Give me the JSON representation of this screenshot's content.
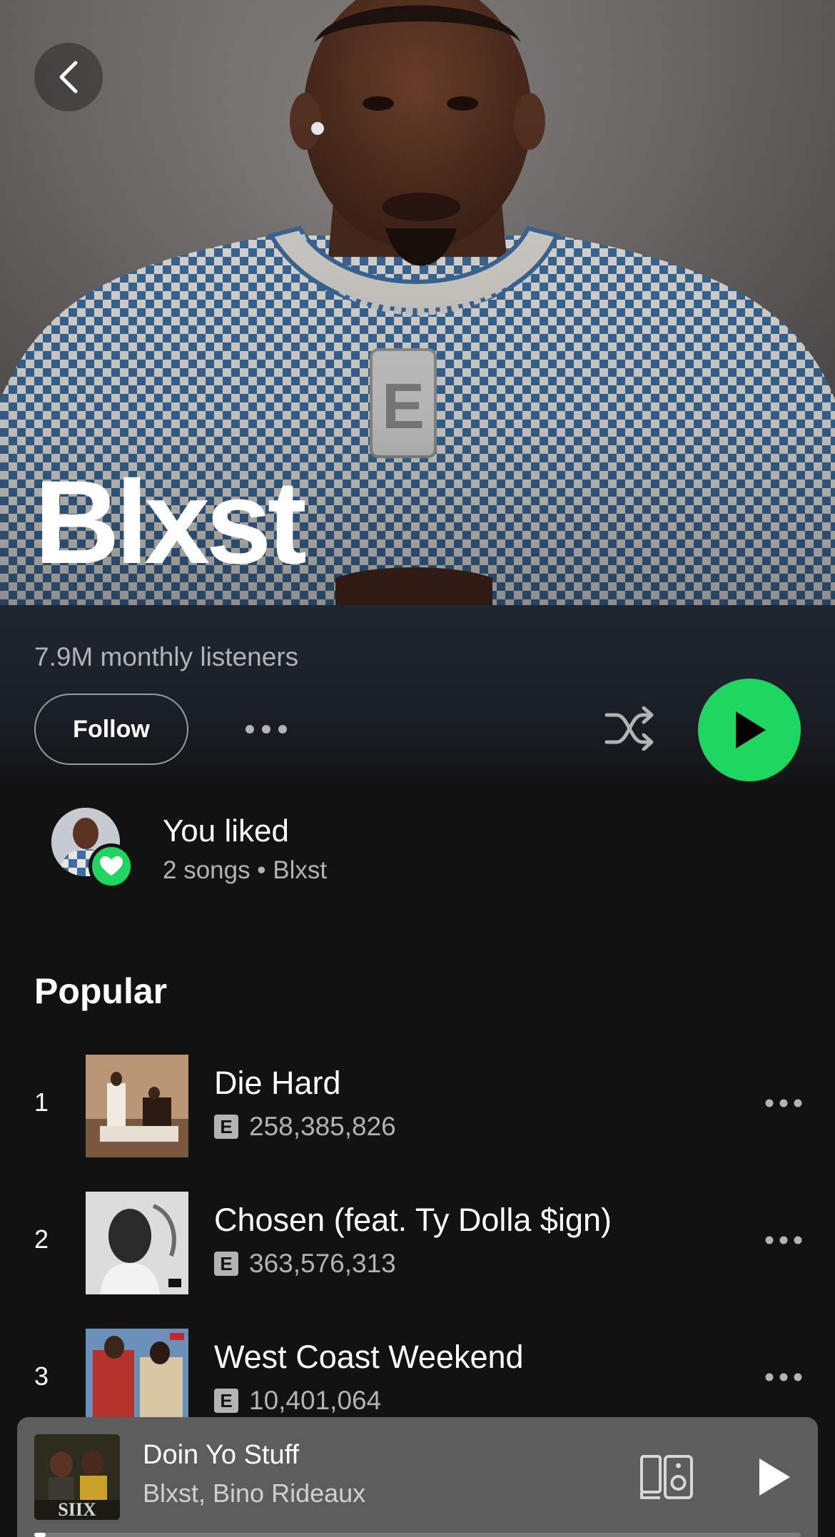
{
  "artist": {
    "name": "Blxst",
    "monthly_listeners": "7.9M monthly listeners"
  },
  "actions": {
    "follow_label": "Follow",
    "more_icon": "more-horizontal-icon",
    "shuffle_icon": "shuffle-icon",
    "play_icon": "play-icon",
    "back_icon": "chevron-left-icon"
  },
  "liked": {
    "title": "You liked",
    "subtitle": "2 songs • Blxst"
  },
  "popular": {
    "heading": "Popular",
    "tracks": [
      {
        "rank": "1",
        "title": "Die Hard",
        "explicit": "E",
        "plays": "258,385,826"
      },
      {
        "rank": "2",
        "title": "Chosen (feat. Ty Dolla $ign)",
        "explicit": "E",
        "plays": "363,576,313"
      },
      {
        "rank": "3",
        "title": "West Coast Weekend",
        "explicit": "E",
        "plays": "10,401,064"
      }
    ]
  },
  "now_playing": {
    "title": "Doin Yo Stuff",
    "artists": "Blxst, Bino Rideaux",
    "progress": 0.015,
    "art_label": "SIIX"
  },
  "colors": {
    "accent": "#1ed760",
    "background": "#121212",
    "mini_player": "#5d5d5d",
    "header_band": "#1f2630"
  }
}
